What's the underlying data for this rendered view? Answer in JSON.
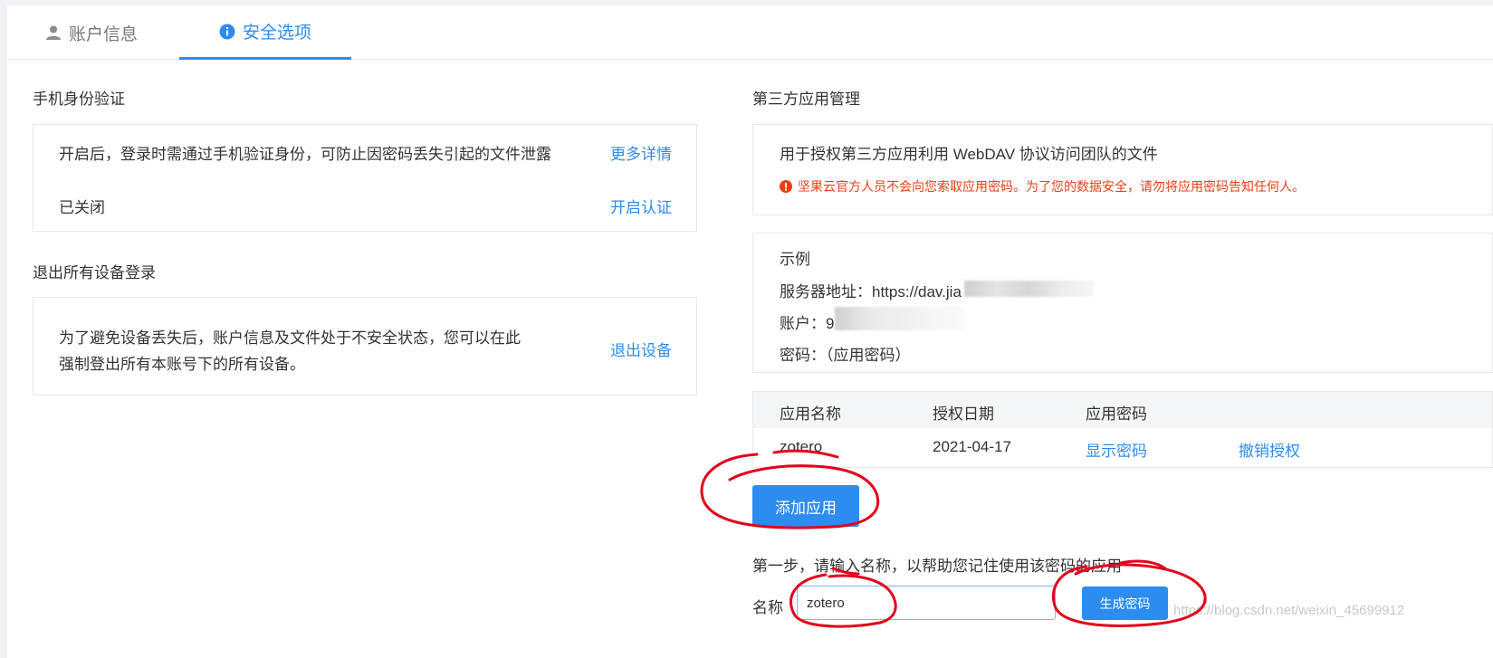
{
  "tabs": [
    {
      "label": "账户信息",
      "icon": "user-icon"
    },
    {
      "label": "安全选项",
      "icon": "info-icon",
      "active": true
    }
  ],
  "phone_auth": {
    "title": "手机身份验证",
    "description": "开启后，登录时需通过手机验证身份，可防止因密码丢失引起的文件泄露",
    "more_link": "更多详情",
    "status": "已关闭",
    "enable_link": "开启认证"
  },
  "logout_all": {
    "title": "退出所有设备登录",
    "description_line1": "为了避免设备丢失后，账户信息及文件处于不安全状态，您可以在此",
    "description_line2": "强制登出所有本账号下的所有设备。",
    "logout_link": "退出设备"
  },
  "third_party": {
    "title": "第三方应用管理",
    "description": "用于授权第三方应用利用 WebDAV 协议访问团队的文件",
    "warning": "坚果云官方人员不会向您索取应用密码。为了您的数据安全，请勿将应用密码告知任何人。",
    "example": {
      "title": "示例",
      "server_label": "服务器地址：",
      "server_value": "https://dav.jia",
      "account_label": "账户：",
      "account_value": "9",
      "password_label": "密码：",
      "password_value": "（应用密码）"
    },
    "table": {
      "headers": [
        "应用名称",
        "授权日期",
        "应用密码"
      ],
      "rows": [
        {
          "name": "zotero",
          "date": "2021-04-17",
          "show": "显示密码",
          "revoke": "撤销授权"
        }
      ]
    },
    "add_button": "添加应用",
    "step_text": "第一步，请输入名称，以帮助您记住使用该密码的应用",
    "name_label": "名称",
    "name_value": "zotero",
    "generate_button": "生成密码"
  },
  "watermark": "https://blog.csdn.net/weixin_45699912",
  "colors": {
    "accent": "#2d8cf0",
    "warning": "#ed3f14",
    "annotation": "#e3001b"
  }
}
